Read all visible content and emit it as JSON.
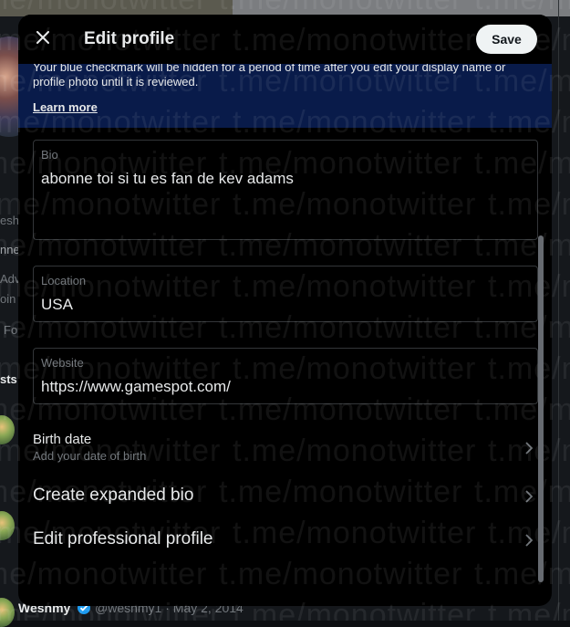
{
  "modal": {
    "title": "Edit profile",
    "save_label": "Save"
  },
  "notice": {
    "text": "Your blue checkmark will be hidden for a period of time after you edit your display name or profile photo until it is reviewed.",
    "learn_more": "Learn more"
  },
  "fields": {
    "bio": {
      "label": "Bio",
      "value": "abonne toi si tu es fan de kev adams"
    },
    "location": {
      "label": "Location",
      "value": "USA"
    },
    "website": {
      "label": "Website",
      "value": "https://www.gamespot.com/"
    }
  },
  "birth_date": {
    "title": "Birth date",
    "subtitle": "Add your date of birth"
  },
  "rows": {
    "expanded_bio": "Create expanded bio",
    "professional_profile": "Edit professional profile"
  },
  "background": {
    "fragments": [
      "esh",
      "nne",
      "Adv",
      "oin",
      "Fo",
      "sts"
    ],
    "tweet_author": "Weshmy",
    "tweet_handle_date": "@weshmy1 · May 2, 2014"
  },
  "watermark": "t.me/monotwitter",
  "icons": {
    "close": "close-icon",
    "chevron": "chevron-right-icon",
    "verified": "verified-badge-icon"
  },
  "colors": {
    "notice_bg": "#091b4a",
    "save_bg": "#eff3f4",
    "verified": "#1d9bf0"
  }
}
